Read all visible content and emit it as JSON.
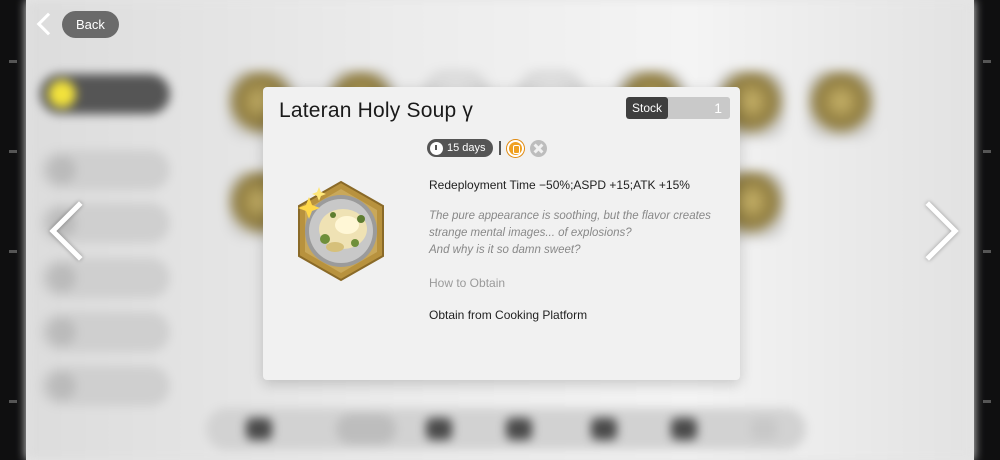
{
  "back_button": {
    "label": "Back"
  },
  "item": {
    "name": "Lateran Holy Soup γ",
    "stock_label": "Stock",
    "stock_value": "1",
    "duration": "15 days",
    "effect": "Redeployment Time −50%;ASPD +15;ATK +15%",
    "flavor_lines": [
      "The pure appearance is soothing, but the flavor creates",
      "strange mental images... of explosions?",
      "And why is it so damn sweet?"
    ],
    "obtain_heading": "How to Obtain",
    "obtain_value": "Obtain from Cooking Platform"
  },
  "icons": {
    "back": "chevron-left-icon",
    "prev": "chevron-left-icon",
    "next": "chevron-right-icon",
    "duration": "clock-icon",
    "badge": "badge-icon",
    "cancel": "cancel-icon"
  },
  "colors": {
    "card_bg": "#f1f1f1",
    "tag_bg": "#555555",
    "badge": "#f0a020",
    "stock_label_bg": "#3f3f3f"
  }
}
